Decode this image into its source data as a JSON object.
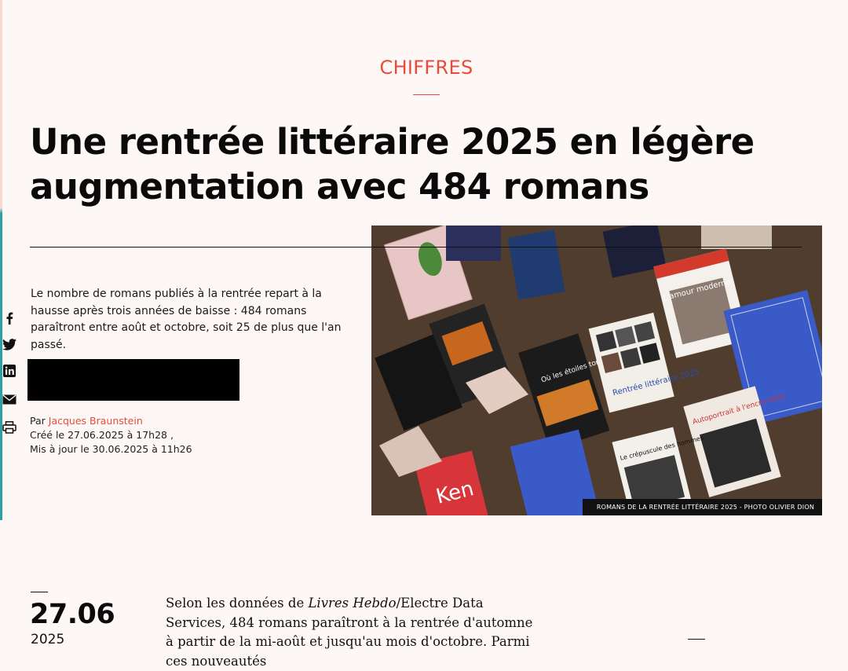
{
  "article": {
    "category": "CHIFFRES",
    "headline": "Une rentrée littéraire 2025 en légère augmentation avec 484 romans",
    "lede": "Le nombre de romans publiés à la rentrée repart à la hausse après trois années de baisse : 484 romans paraîtront entre août et octobre, soit 25 de plus que l'an passé.",
    "image_caption": "ROMANS DE LA RENTRÉE LITTÉRAIRE 2025 - PHOTO OLIVIER DION",
    "byline": {
      "prefix": "Par",
      "author": "Jacques Braunstein",
      "created": "Créé le 27.06.2025 à 17h28 ,",
      "updated": "Mis à jour le 30.06.2025 à 11h26"
    },
    "date": {
      "day_month": "27.06",
      "year": "2025"
    },
    "body": {
      "intro": "Selon les données de ",
      "source_italic": "Livres Hebdo",
      "rest": "/Electre Data Services, 484 romans paraîtront à la rentrée d'automne à partir de la mi-août et jusqu'au mois d'octobre. Parmi ces nouveautés"
    }
  },
  "share": {
    "items": [
      "facebook-icon",
      "twitter-icon",
      "linkedin-icon",
      "email-icon",
      "print-icon"
    ]
  },
  "colors": {
    "accent": "#e84b3a",
    "background": "#fdf8f6",
    "text": "#111111"
  },
  "photo_book_titles": {
    "amour": "L'amour moderne",
    "etoiles": "Où les étoiles tombent",
    "autoportrait": "Autoportrait à l'encre noire",
    "crepuscule": "Le crépuscule des hommes",
    "rentree": "Rentrée littéraire 2025",
    "ken": "Ken"
  }
}
